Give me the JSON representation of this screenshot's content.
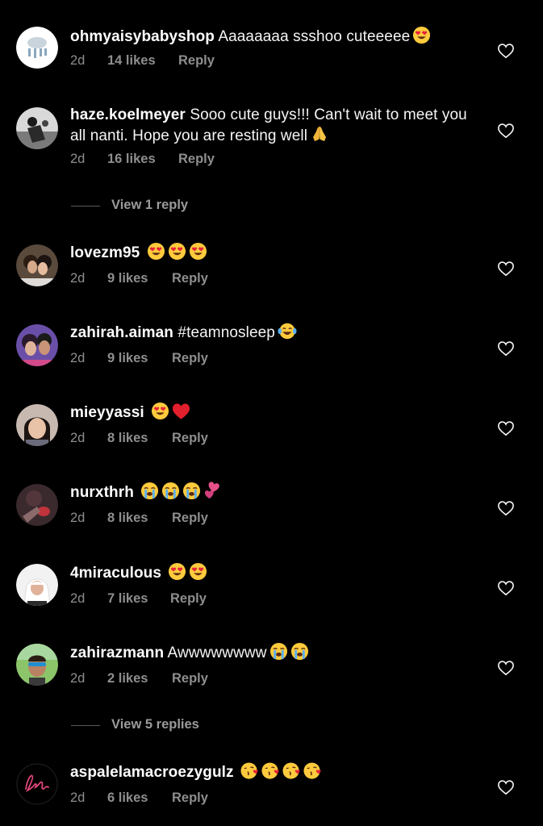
{
  "comments": [
    {
      "username": "ohmyaisybabyshop",
      "text": "Aaaaaaaa ssshoo cuteeeee",
      "emojis": [
        "heart-eyes"
      ],
      "time": "2d",
      "likes": "14 likes",
      "reply": "Reply"
    },
    {
      "username": "haze.koelmeyer",
      "text": "Sooo cute guys!!! Can't wait to meet you all nanti. Hope you are resting well",
      "emojis": [
        "folded-hands"
      ],
      "time": "2d",
      "likes": "16 likes",
      "reply": "Reply"
    },
    {
      "username": "lovezm95",
      "text": "",
      "emojis": [
        "heart-eyes",
        "heart-eyes",
        "heart-eyes"
      ],
      "time": "2d",
      "likes": "9 likes",
      "reply": "Reply"
    },
    {
      "username": "zahirah.aiman",
      "text": "#teamnosleep",
      "emojis": [
        "tears-of-joy"
      ],
      "time": "2d",
      "likes": "9 likes",
      "reply": "Reply"
    },
    {
      "username": "mieyyassi",
      "text": "",
      "emojis": [
        "heart-eyes",
        "red-heart"
      ],
      "time": "2d",
      "likes": "8 likes",
      "reply": "Reply"
    },
    {
      "username": "nurxthrh",
      "text": "",
      "emojis": [
        "loudly-crying",
        "loudly-crying",
        "loudly-crying",
        "two-hearts"
      ],
      "time": "2d",
      "likes": "8 likes",
      "reply": "Reply"
    },
    {
      "username": "4miraculous",
      "text": "",
      "emojis": [
        "heart-eyes",
        "heart-eyes"
      ],
      "time": "2d",
      "likes": "7 likes",
      "reply": "Reply"
    },
    {
      "username": "zahirazmann",
      "text": "Awwwwwwww",
      "emojis": [
        "loudly-crying",
        "loudly-crying"
      ],
      "time": "2d",
      "likes": "2 likes",
      "reply": "Reply"
    },
    {
      "username": "aspalelamacroezygulz",
      "text": "",
      "emojis": [
        "kissing-heart",
        "kissing-heart",
        "kissing-heart",
        "kissing-heart"
      ],
      "time": "2d",
      "likes": "6 likes",
      "reply": "Reply"
    }
  ],
  "view_replies": [
    {
      "label": "View 1 reply"
    },
    {
      "label": "View 5 replies"
    }
  ],
  "colors": {
    "background": "#000000",
    "text": "#f5f5f5",
    "muted": "#8e8e8e"
  }
}
